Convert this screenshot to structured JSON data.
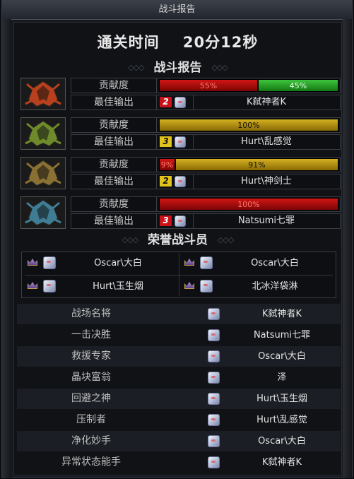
{
  "window": {
    "title": "战斗报告"
  },
  "clear_time": {
    "label": "通关时间",
    "value": "20分12秒"
  },
  "battle_report": {
    "heading": "战斗报告",
    "contribution_label": "贡献度",
    "best_output_label": "最佳输出",
    "members": [
      {
        "job_icon": "flame-crest-icon",
        "job_color": "#b8401c",
        "segments": [
          {
            "text": "55%",
            "percent": 55,
            "color": "red"
          },
          {
            "text": "45%",
            "percent": 45,
            "color": "green"
          }
        ],
        "rank": "2",
        "rank_color": "red",
        "player": "K弑神者K"
      },
      {
        "job_icon": "leaf-crest-icon",
        "job_color": "#6f8a2a",
        "segments": [
          {
            "text": "100%",
            "percent": 100,
            "color": "gold"
          }
        ],
        "rank": "3",
        "rank_color": "gold",
        "player": "Hurt\\乱感觉"
      },
      {
        "job_icon": "bronze-crest-icon",
        "job_color": "#8a7032",
        "segments": [
          {
            "text": "9%",
            "percent": 9,
            "color": "red"
          },
          {
            "text": "91%",
            "percent": 91,
            "color": "gold"
          }
        ],
        "rank": "2",
        "rank_color": "gold",
        "player": "Hurt\\神剑士"
      },
      {
        "job_icon": "ice-crest-icon",
        "job_color": "#3f7d95",
        "segments": [
          {
            "text": "100%",
            "percent": 100,
            "color": "red"
          }
        ],
        "rank": "3",
        "rank_color": "red",
        "player": "Natsumi七罪"
      }
    ]
  },
  "honor": {
    "heading": "荣誉战斗员",
    "members": [
      "Oscar\\大白",
      "Oscar\\大白",
      "Hurt\\玉生烟",
      "北冰洋袋淋"
    ]
  },
  "awards": [
    {
      "title": "战场名将",
      "player": "K弑神者K"
    },
    {
      "title": "一击决胜",
      "player": "Natsumi七罪"
    },
    {
      "title": "救援专家",
      "player": "Oscar\\大白"
    },
    {
      "title": "晶块富翁",
      "player": "泽"
    },
    {
      "title": "回避之神",
      "player": "Hurt\\玉生烟"
    },
    {
      "title": "压制者",
      "player": "Hurt\\乱感觉"
    },
    {
      "title": "净化妙手",
      "player": "Oscar\\大白"
    },
    {
      "title": "异常状态能手",
      "player": "K弑神者K"
    }
  ]
}
